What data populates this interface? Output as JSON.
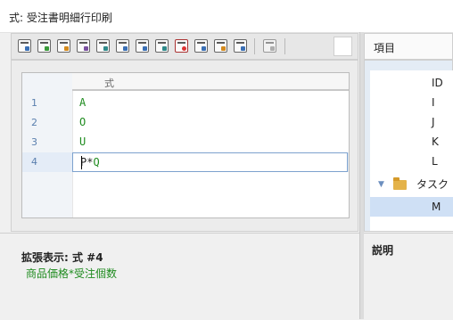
{
  "window": {
    "title": "式: 受注書明細行印刷"
  },
  "toolbar": {
    "buttons": [
      {
        "name": "new-formula-icon",
        "accent": "#3a6fb5"
      },
      {
        "name": "edit-formula-icon",
        "accent": "#3a9b3a"
      },
      {
        "name": "rename-icon",
        "accent": "#d48a1e"
      },
      {
        "name": "copy-formula-icon",
        "accent": "#7a4fa0"
      },
      {
        "name": "insert-field-icon",
        "accent": "#2f8a8a"
      },
      {
        "name": "insert-table-icon",
        "accent": "#3a6fb5"
      },
      {
        "name": "grid-icon",
        "accent": "#3a6fb5"
      },
      {
        "name": "user-icon",
        "accent": "#2f8a8a"
      },
      {
        "name": "delete-icon",
        "accent": "#d33"
      },
      {
        "name": "document-icon",
        "accent": "#3a6fb5"
      },
      {
        "name": "people-icon",
        "accent": "#d48a1e"
      },
      {
        "name": "window-icon",
        "accent": "#3a6fb5"
      },
      {
        "name": "export-icon",
        "accent": "#888"
      }
    ]
  },
  "editor": {
    "column_header": "式",
    "rows": [
      {
        "num": "1",
        "formula": "A"
      },
      {
        "num": "2",
        "formula": "O"
      },
      {
        "num": "3",
        "formula": "U"
      }
    ],
    "active_row": {
      "num": "4",
      "part1": "P",
      "op": "*",
      "part2": "Q"
    }
  },
  "expanded": {
    "title": "拡張表示: 式 #4",
    "text": "商品価格*受注個数"
  },
  "right_panel": {
    "header": "項目",
    "items": [
      {
        "label": "ID"
      },
      {
        "label": "I"
      },
      {
        "label": "J"
      },
      {
        "label": "K"
      },
      {
        "label": "L"
      }
    ],
    "folder_label": "タスク",
    "selected_item": "M",
    "description_title": "説明"
  },
  "colors": {
    "formula_green": "#1e8b1e",
    "selection_blue": "#e4ecf7",
    "row_number_blue": "#5a7fae"
  }
}
